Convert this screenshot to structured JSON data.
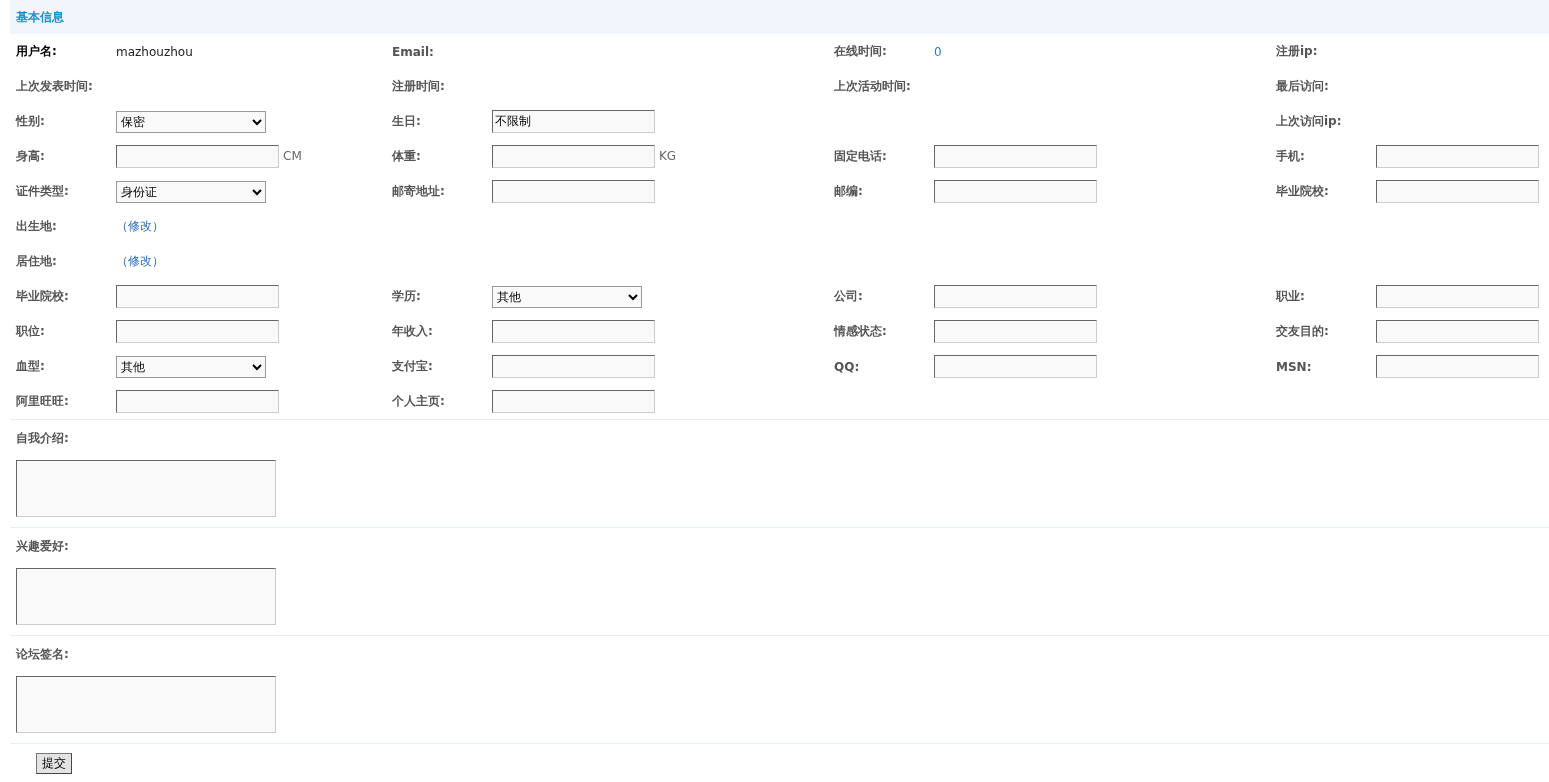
{
  "section_title": "基本信息",
  "rows": [
    {
      "cells": [
        {
          "label": "用户名:",
          "strong": true,
          "kind": "text",
          "value": "mazhouzhou"
        },
        {
          "label": "Email:",
          "kind": "none"
        },
        {
          "label": "在线时间:",
          "kind": "count",
          "value": "0"
        },
        {
          "label": "注册ip:",
          "kind": "none"
        }
      ]
    },
    {
      "cells": [
        {
          "label": "上次发表时间:",
          "kind": "none"
        },
        {
          "label": "注册时间:",
          "kind": "none"
        },
        {
          "label": "上次活动时间:",
          "kind": "none"
        },
        {
          "label": "最后访问:",
          "kind": "none"
        }
      ]
    },
    {
      "cells": [
        {
          "label": "性别:",
          "kind": "select",
          "value": "保密"
        },
        {
          "label": "生日:",
          "kind": "input",
          "value": "不限制"
        },
        {
          "kind": "empty"
        },
        {
          "label": "上次访问ip:",
          "kind": "none"
        }
      ]
    },
    {
      "cells": [
        {
          "label": "身高:",
          "kind": "input",
          "unit": "CM"
        },
        {
          "label": "体重:",
          "kind": "input",
          "unit": "KG"
        },
        {
          "label": "固定电话:",
          "kind": "input"
        },
        {
          "label": "手机:",
          "kind": "input"
        }
      ]
    },
    {
      "cells": [
        {
          "label": "证件类型:",
          "kind": "select",
          "value": "身份证"
        },
        {
          "label": "邮寄地址:",
          "kind": "input"
        },
        {
          "label": "邮编:",
          "kind": "input"
        },
        {
          "label": "毕业院校:",
          "kind": "input"
        }
      ]
    },
    {
      "cells": [
        {
          "label": "出生地:",
          "kind": "link",
          "value": "（修改）"
        },
        {
          "kind": "empty"
        },
        {
          "kind": "empty"
        },
        {
          "kind": "empty"
        }
      ]
    },
    {
      "cells": [
        {
          "label": "居住地:",
          "kind": "link",
          "value": "（修改）"
        },
        {
          "kind": "empty"
        },
        {
          "kind": "empty"
        },
        {
          "kind": "empty"
        }
      ]
    },
    {
      "cells": [
        {
          "label": "毕业院校:",
          "kind": "input"
        },
        {
          "label": "学历:",
          "kind": "select",
          "value": "其他"
        },
        {
          "label": "公司:",
          "kind": "input"
        },
        {
          "label": "职业:",
          "kind": "input"
        }
      ]
    },
    {
      "cells": [
        {
          "label": "职位:",
          "kind": "input"
        },
        {
          "label": "年收入:",
          "kind": "input"
        },
        {
          "label": "情感状态:",
          "kind": "input"
        },
        {
          "label": "交友目的:",
          "kind": "input"
        }
      ]
    },
    {
      "cells": [
        {
          "label": "血型:",
          "kind": "select",
          "value": "其他"
        },
        {
          "label": "支付宝:",
          "kind": "input"
        },
        {
          "label": "QQ:",
          "kind": "input"
        },
        {
          "label": "MSN:",
          "kind": "input"
        }
      ]
    },
    {
      "cells": [
        {
          "label": "阿里旺旺:",
          "kind": "input"
        },
        {
          "label": "个人主页:",
          "kind": "input"
        },
        {
          "kind": "empty"
        },
        {
          "kind": "empty"
        }
      ]
    }
  ],
  "text_areas": [
    {
      "label": "自我介绍:"
    },
    {
      "label": "兴趣爱好:"
    },
    {
      "label": "论坛签名:"
    }
  ],
  "submit": "提交"
}
